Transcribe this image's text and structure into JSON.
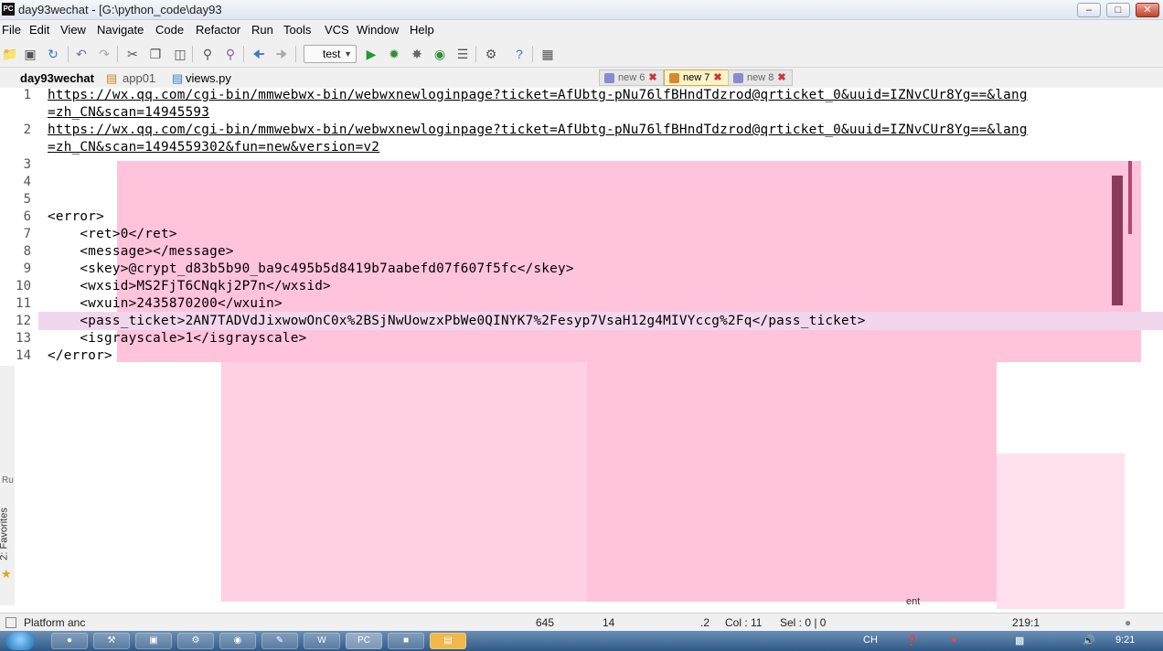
{
  "window": {
    "title": "day93wechat - [G:\\python_code\\day93",
    "app_icon": "PC",
    "controls": [
      "minimize-icon",
      "maximize-icon",
      "close-icon"
    ]
  },
  "menu": [
    "File",
    "Edit",
    "View",
    "Navigate",
    "Code",
    "Refactor",
    "Run",
    "Tools",
    "VCS",
    "Window",
    "Help"
  ],
  "toolbar": {
    "run_config": "test",
    "icons": [
      "open-icon",
      "save-icon",
      "sync-icon",
      "undo-icon",
      "redo-icon",
      "cut-icon",
      "copy-icon",
      "paste-icon",
      "find-icon",
      "replace-icon",
      "back-icon",
      "forward-icon",
      "run-icon",
      "debug-icon",
      "coverage-icon",
      "profile-icon",
      "concurrency-icon",
      "settings-icon",
      "help-icon",
      "vcs-icon"
    ]
  },
  "breadcrumb": {
    "project": "day93wechat",
    "folder": "app01",
    "file": "views.py"
  },
  "tabs": [
    {
      "label": "new 6",
      "active": false
    },
    {
      "label": "new 7",
      "active": true
    },
    {
      "label": "new 8",
      "active": false
    }
  ],
  "editor": {
    "line_numbers": [
      "1",
      "",
      "2",
      "",
      "3",
      "4",
      "5",
      "6",
      "7",
      "8",
      "9",
      "10",
      "11",
      "12",
      "13",
      "14"
    ],
    "lines": [
      "https://wx.qq.com/cgi-bin/mmwebwx-bin/webwxnewloginpage?ticket=AfUbtg-pNu76lfBHndTdzrod@qrticket_0&uuid=IZNvCUr8Yg==&lang",
      "=zh_CN&scan=14945593",
      "https://wx.qq.com/cgi-bin/mmwebwx-bin/webwxnewloginpage?ticket=AfUbtg-pNu76lfBHndTdzrod@qrticket_0&uuid=IZNvCUr8Yg==&lang",
      "=zh_CN&scan=1494559302&fun=new&version=v2",
      "",
      "",
      "",
      "<error>",
      "    <ret>0</ret>",
      "    <message></message>",
      "    <skey>@crypt_d83b5b90_ba9c495b5d8419b7aabefd07f607f5fc</skey>",
      "    <wxsid>MS2FjT6CNqkj2P7n</wxsid>",
      "    <wxuin>2435870200</wxuin>",
      "    <pass_ticket>2AN7TADVdJixwowOnC0x%2BSjNwUowzxPbWe0QINYK7%2Fesyp7VsaH12g4MIVYccg%2Fq</pass_ticket>",
      "    <isgrayscale>1</isgrayscale>",
      "</error>"
    ],
    "highlighted_line": "12"
  },
  "side_panel": {
    "favorites_label": "2: Favorites",
    "run_label": "Ru"
  },
  "status": {
    "left": "Platform anc",
    "length": "645",
    "lines": "14",
    "ln": ".2",
    "col": "Col : 11",
    "sel": "Sel : 0 | 0",
    "pos": "219:1",
    "right_fragments": [
      "ent"
    ]
  },
  "taskbar": {
    "apps": [
      "firefox-icon",
      "tools-icon",
      "save-icon",
      "wrench-icon",
      "chrome-icon",
      "notepad-icon",
      "word-icon",
      "pycharm-icon",
      "app-icon",
      "folder-icon"
    ],
    "tray": {
      "lang": "CH",
      "clock": "9:21"
    }
  },
  "colors": {
    "overlay_pink": "#ffc3dc",
    "line_highlight": "#f2d6ee",
    "active_tab": "#fff3c8"
  }
}
